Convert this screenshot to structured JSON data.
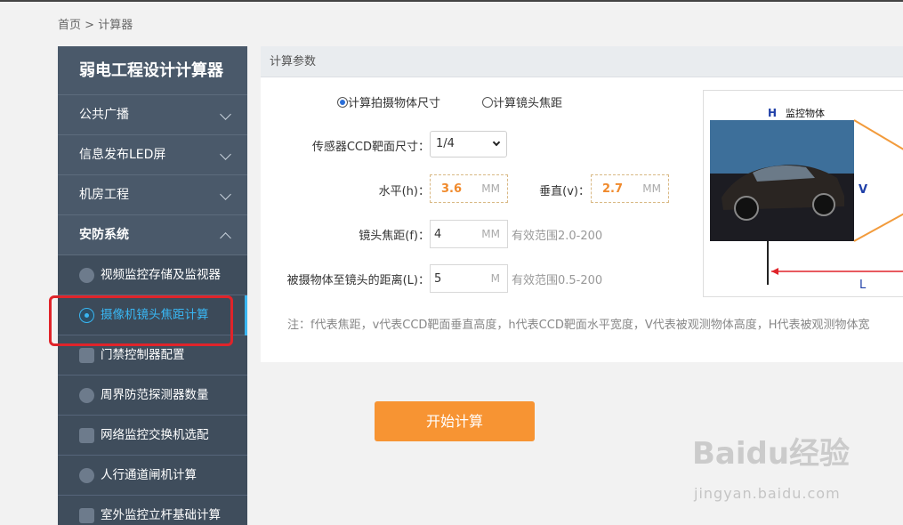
{
  "breadcrumb": {
    "home": "首页",
    "separator": " > ",
    "current": "计算器"
  },
  "sidebar": {
    "title": "弱电工程设计计算器",
    "categories": [
      {
        "label": "公共广播"
      },
      {
        "label": "信息发布LED屏"
      },
      {
        "label": "机房工程"
      },
      {
        "label": "安防系统"
      }
    ],
    "subitems": [
      {
        "label": "视频监控存储及监视器"
      },
      {
        "label": "摄像机镜头焦距计算"
      },
      {
        "label": "门禁控制器配置"
      },
      {
        "label": "周界防范探测器数量"
      },
      {
        "label": "网络监控交换机选配"
      },
      {
        "label": "人行通道闸机计算"
      },
      {
        "label": "室外监控立杆基础计算"
      }
    ]
  },
  "panel": {
    "header": "计算参数",
    "radio_size": "计算拍摄物体尺寸",
    "radio_focal": "计算镜头焦距",
    "sensor_label": "传感器CCD靶面尺寸：",
    "sensor_value": "1/4",
    "horizontal_label": "水平(h)：",
    "horizontal_value": "3.6",
    "vertical_label": "垂直(v)：",
    "vertical_value": "2.7",
    "unit_mm": "MM",
    "unit_m": "M",
    "focal_label": "镜头焦距(f)：",
    "focal_value": "4",
    "focal_hint": "有效范围2.0-200",
    "distance_label": "被摄物体至镜头的距离(L)：",
    "distance_value": "5",
    "distance_hint": "有效范围0.5-200",
    "note": "注：f代表焦距，v代表CCD靶面垂直高度，h代表CCD靶面水平宽度，V代表被观测物体高度，H代表被观测物体宽"
  },
  "diagram": {
    "H": "H",
    "object_label": "监控物体",
    "V": "V",
    "L": "L"
  },
  "actions": {
    "calculate": "开始计算"
  },
  "watermark": {
    "logo": "Baidu经验",
    "url": "jingyan.baidu.com"
  }
}
